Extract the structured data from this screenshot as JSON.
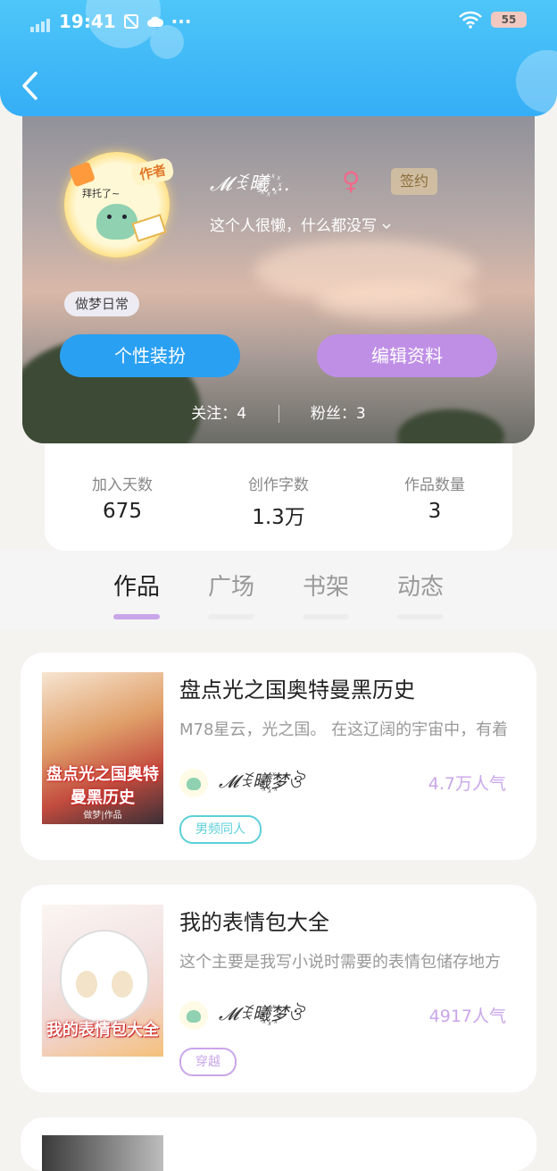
{
  "status_bar": {
    "time": "19:41",
    "more": "···",
    "battery": "55"
  },
  "profile": {
    "username": "𝓜ꉂ曦꙰…",
    "gender_symbol": "♀",
    "signed_badge": "签约",
    "bio": "这个人很懒，什么都没写",
    "avatar_ribbon": "作者",
    "avatar_text": "拜托了~",
    "tag": "做梦日常",
    "dress_button": "个性装扮",
    "edit_button": "编辑资料",
    "following": "关注：4",
    "followers": "粉丝：3"
  },
  "stats": [
    {
      "label": "加入天数",
      "value": "675"
    },
    {
      "label": "创作字数",
      "value": "1.3万"
    },
    {
      "label": "作品数量",
      "value": "3"
    }
  ],
  "tabs": [
    "作品",
    "广场",
    "书架",
    "动态"
  ],
  "works": [
    {
      "title": "盘点光之国奥特曼黑历史",
      "desc": "M78星云，光之国。        在这辽阔的宇宙中，有着",
      "author": "𝓜ꉂ曦꙰梦ঔ",
      "popularity": "4.7万人气",
      "tag": "男频同人",
      "cover_title": "盘点光之国奥特曼黑历史",
      "cover_sub": "做梦|作品"
    },
    {
      "title": "我的表情包大全",
      "desc": "这个主要是我写小说时需要的表情包储存地方",
      "author": "𝓜ꉂ曦꙰梦ঔ",
      "popularity": "4917人气",
      "tag": "穿越",
      "cover_title": "我的表情包大全"
    }
  ],
  "colors": {
    "header": "#35aef6",
    "accent_purple": "#c9a6ea",
    "button_blue": "#2aa0f2",
    "tag_cyan": "#5cd0d8"
  }
}
